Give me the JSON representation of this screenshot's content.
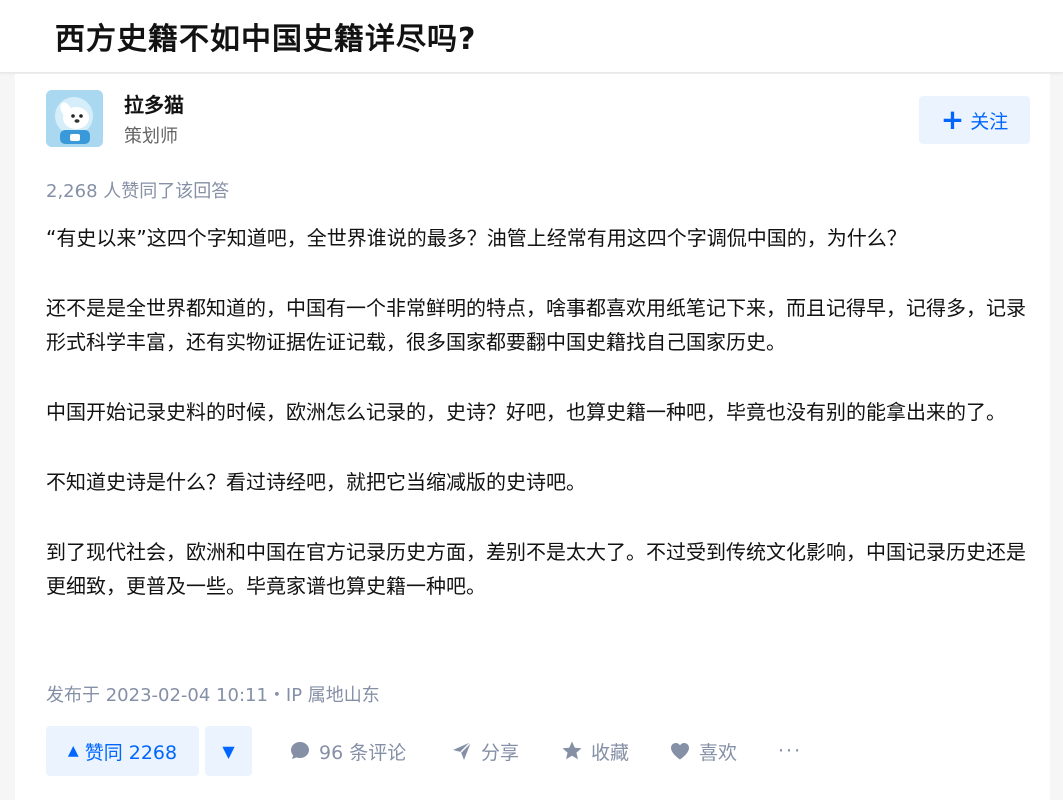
{
  "question": {
    "title": "西方史籍不如中国史籍详尽吗?"
  },
  "author": {
    "name": "拉多猫",
    "title": "策划师",
    "avatar_icon": "cartoon-dog-avatar"
  },
  "follow_button": {
    "icon": "plus-icon",
    "label": "关注"
  },
  "answer": {
    "vote_summary": "2,268 人赞同了该回答",
    "paragraphs": [
      "“有史以来”这四个字知道吧，全世界谁说的最多？油管上经常有用这四个字调侃中国的，为什么？",
      "还不是是全世界都知道的，中国有一个非常鲜明的特点，啥事都喜欢用纸笔记下来，而且记得早，记得多，记录形式科学丰富，还有实物证据佐证记载，很多国家都要翻中国史籍找自己国家历史。",
      "中国开始记录史料的时候，欧洲怎么记录的，史诗？好吧，也算史籍一种吧，毕竟也没有别的能拿出来的了。",
      "不知道史诗是什么？看过诗经吧，就把它当缩减版的史诗吧。",
      "到了现代社会，欧洲和中国在官方记录历史方面，差别不是太大了。不过受到传统文化影响，中国记录历史还是更细致，更普及一些。毕竟家谱也算史籍一种吧。"
    ],
    "meta": "发布于 2023-02-04 10:11・IP 属地山东"
  },
  "actions": {
    "upvote_label": "赞同 2268",
    "comments_label": "96 条评论",
    "share_label": "分享",
    "collect_label": "收藏",
    "like_label": "喜欢",
    "more_label": "···"
  },
  "colors": {
    "accent": "#0066ff",
    "accent_bg": "#ebf3ff",
    "muted": "#8590a6"
  }
}
